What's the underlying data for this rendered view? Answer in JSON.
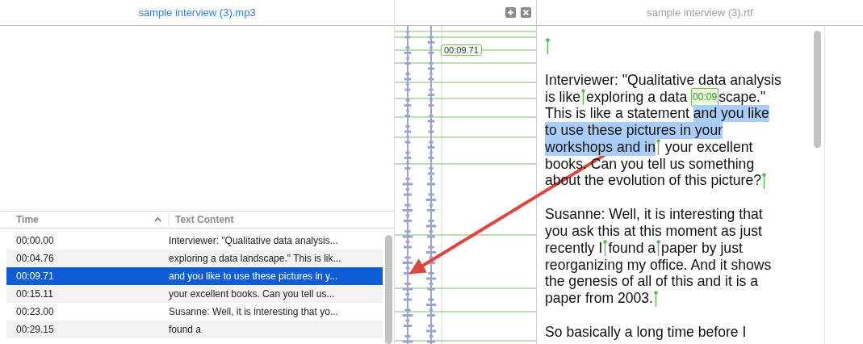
{
  "audio_pane": {
    "title": "sample interview (3).mp3",
    "waveform": {
      "timestamp": "00:09.71"
    },
    "table": {
      "columns": [
        {
          "label": "Time",
          "sorted": true
        },
        {
          "label": "Text Content",
          "sorted": false
        }
      ],
      "rows": [
        {
          "time": "00:00.00",
          "text": "Interviewer: \"Qualitative data analysis...",
          "selected": false
        },
        {
          "time": "00:04.76",
          "text": "exploring a data landscape.\" This is lik...",
          "selected": false
        },
        {
          "time": "00:09.71",
          "text": "and you like to use these pictures in y...",
          "selected": true
        },
        {
          "time": "00:15.11",
          "text": "your excellent books. Can you tell us...",
          "selected": false
        },
        {
          "time": "00:23.00",
          "text": "Susanne: Well, it is interesting that yo...",
          "selected": false
        },
        {
          "time": "00:29.15",
          "text": "found a",
          "selected": false
        }
      ]
    }
  },
  "text_pane": {
    "title": "sample interview (3).rtf",
    "paragraphs": [
      [
        [
          {
            "kind": "pin"
          }
        ]
      ],
      [
        [
          {
            "kind": "text",
            "text": "Interviewer: \"Qualitative data analysis"
          }
        ],
        [
          {
            "kind": "text",
            "text": "is like"
          },
          {
            "kind": "pin"
          },
          {
            "kind": "text",
            "text": "exploring a data "
          },
          {
            "kind": "timestamp",
            "text": "00:09"
          },
          {
            "kind": "text",
            "text": "scape.\""
          }
        ],
        [
          {
            "kind": "text",
            "text": "This is like a statement "
          },
          {
            "kind": "highlight",
            "text": "and you like"
          }
        ],
        [
          {
            "kind": "highlight",
            "text": "to use these pictures in your"
          }
        ],
        [
          {
            "kind": "highlight",
            "text": "workshops and in"
          },
          {
            "kind": "pin"
          },
          {
            "kind": "text",
            "text": " your excellent"
          }
        ],
        [
          {
            "kind": "text",
            "text": "books. Can you tell us something"
          }
        ],
        [
          {
            "kind": "text",
            "text": "about the evolution of this picture?"
          },
          {
            "kind": "pin"
          }
        ]
      ],
      [
        [
          {
            "kind": "text",
            "text": "Susanne: Well, it is interesting that"
          }
        ],
        [
          {
            "kind": "text",
            "text": "you ask this at this moment as just"
          }
        ],
        [
          {
            "kind": "text",
            "text": "recently I"
          },
          {
            "kind": "pin"
          },
          {
            "kind": "text",
            "text": "found a"
          },
          {
            "kind": "pin"
          },
          {
            "kind": "text",
            "text": "paper by just"
          }
        ],
        [
          {
            "kind": "text",
            "text": "reorganizing my office. And it shows"
          }
        ],
        [
          {
            "kind": "text",
            "text": "the genesis of all of this and it is a"
          }
        ],
        [
          {
            "kind": "text",
            "text": "paper from 2003."
          },
          {
            "kind": "pin"
          }
        ]
      ],
      [
        [
          {
            "kind": "text",
            "text": "So basically a long time before I"
          }
        ]
      ]
    ]
  }
}
